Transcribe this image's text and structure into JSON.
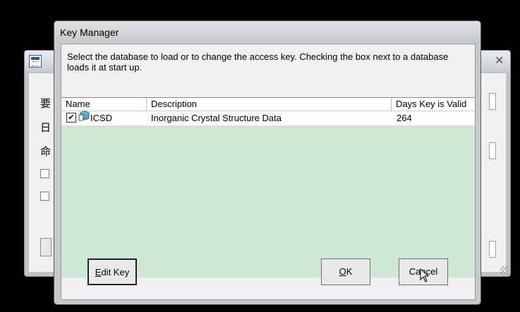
{
  "background_window": {
    "chars": [
      "要",
      "日",
      "命"
    ]
  },
  "dialog": {
    "title": "Key Manager",
    "instructions": "Select the database to load or to change the access key.  Checking the box next to a database loads it at start up.",
    "columns": [
      "Name",
      "Description",
      "Days Key is Valid"
    ],
    "rows": [
      {
        "checked": true,
        "icon": "database-icon",
        "name": "ICSD",
        "description": "Inorganic Crystal Structure Data",
        "days": "264"
      }
    ],
    "buttons": {
      "edit_key_prefix": "",
      "edit_key_underline": "E",
      "edit_key_rest": "dit Key",
      "ok_underline": "O",
      "ok_rest": "K",
      "cancel_prefix": "Ca",
      "cancel_underline": "n",
      "cancel_rest": "cel"
    }
  },
  "colors": {
    "list_background": "#cde8d3",
    "dialog_face": "#f0f0f0"
  }
}
